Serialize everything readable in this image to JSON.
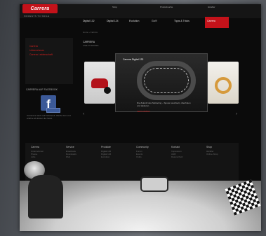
{
  "header": {
    "logo_text": "Carrera",
    "tagline": "MOMENTS TO SMILE",
    "utility": [
      "Shop",
      "Produktsuche",
      "Händler"
    ]
  },
  "nav": {
    "items": [
      "Digital 132",
      "Digital 124",
      "Evolution",
      "Go!!!",
      "Tipps & Tricks"
    ],
    "active": "Carrera"
  },
  "breadcrumb": "Home › Carrera",
  "sidebar": {
    "items": [
      "Carrera",
      "Unternehmen",
      "Carrera Leidenschaft"
    ]
  },
  "facebook": {
    "title": "CARRERA AUF FACEBOOK",
    "icon_letter": "f",
    "text": "Carrera ist auch auf Facebook. Werde Fan und erfahre als Erster die News."
  },
  "main": {
    "heading": "CARRERA",
    "subheading": "LIVE IT RACING",
    "slide_title": "Carrera Digital 132",
    "slide_caption": "Die Zukunft des Slotracing – Spuren wechseln, überholen und taktieren.",
    "slide_link": "mehr erfahren"
  },
  "footer": {
    "columns": [
      {
        "title": "Carrera",
        "links": [
          "Unternehmen",
          "Presse",
          "Jobs"
        ]
      },
      {
        "title": "Service",
        "links": [
          "Ersatzteile",
          "Downloads",
          "FAQ"
        ]
      },
      {
        "title": "Produkte",
        "links": [
          "Digital 132",
          "Digital 124",
          "Evolution"
        ]
      },
      {
        "title": "Community",
        "links": [
          "Forum",
          "Events",
          "Clubs"
        ]
      },
      {
        "title": "Kontakt",
        "links": [
          "Impressum",
          "AGB",
          "Datenschutz"
        ]
      },
      {
        "title": "Shop",
        "links": [
          "Händler",
          "Online-Shop"
        ]
      }
    ]
  },
  "colors": {
    "brand": "#c4121a",
    "facebook": "#3b5998",
    "background": "#0b0b0b"
  }
}
